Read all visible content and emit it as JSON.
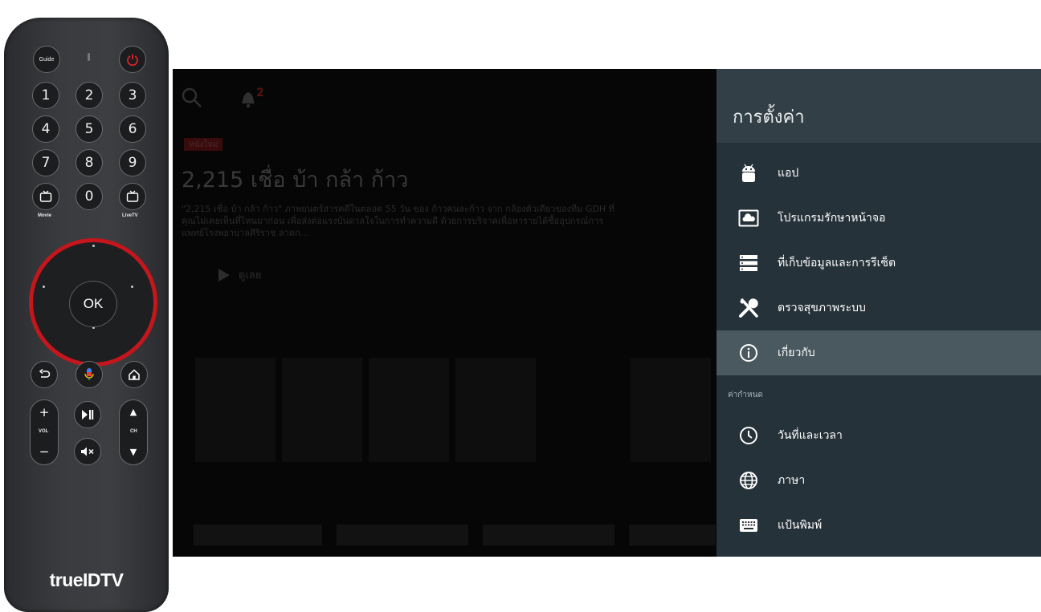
{
  "remote": {
    "guide_label": "Guide",
    "numbers": [
      "1",
      "2",
      "3",
      "4",
      "5",
      "6",
      "7",
      "8",
      "9"
    ],
    "zero": "0",
    "movie_label": "Movie",
    "livetv_label": "LiveTV",
    "ok_label": "OK",
    "vol_label": "VOL",
    "ch_label": "CH",
    "brand": "trueIDTV",
    "accent_color": "#c4161c"
  },
  "tv": {
    "notification_count": "2",
    "badge": "หนังใหม่",
    "hero_title": "2,215 เชื่อ บ้า กล้า ก้าว",
    "hero_description": "\"2,215 เชื่อ บ้า กล้า ก้าว\" ภาพยนตร์สารคดีในตลอด 55 วัน ของ ก้าวคนละก้าว จาก กล้องตัวเดียวของทีม GDH ที่คุณไม่เคยเห็นที่ไหนมาก่อน เพื่อส่งต่อแรงบันดาลใจในการทำความดี ด้วยการบริจาคเพื่อหารายได้ซื้ออุปกรณ์การแพทย์โรงพยาบาลศิริราช ลาดก...",
    "play_label": "ดูเลย"
  },
  "settings": {
    "title": "การตั้งค่า",
    "items": [
      {
        "label": "แอป",
        "icon": "android-icon"
      },
      {
        "label": "โปรแกรมรักษาหน้าจอ",
        "icon": "screensaver-icon"
      },
      {
        "label": "ที่เก็บข้อมูลและการรีเซ็ต",
        "icon": "storage-icon"
      },
      {
        "label": "ตรวจสุขภาพระบบ",
        "icon": "tools-icon"
      },
      {
        "label": "เกี่ยวกับ",
        "icon": "info-icon",
        "selected": true
      }
    ],
    "section_label": "ค่ากำหนด",
    "pref_items": [
      {
        "label": "วันที่และเวลา",
        "icon": "clock-icon"
      },
      {
        "label": "ภาษา",
        "icon": "globe-icon"
      },
      {
        "label": "แป้นพิมพ์",
        "icon": "keyboard-icon"
      }
    ],
    "panel_color": "#26323a",
    "selected_color": "#4a5860"
  }
}
